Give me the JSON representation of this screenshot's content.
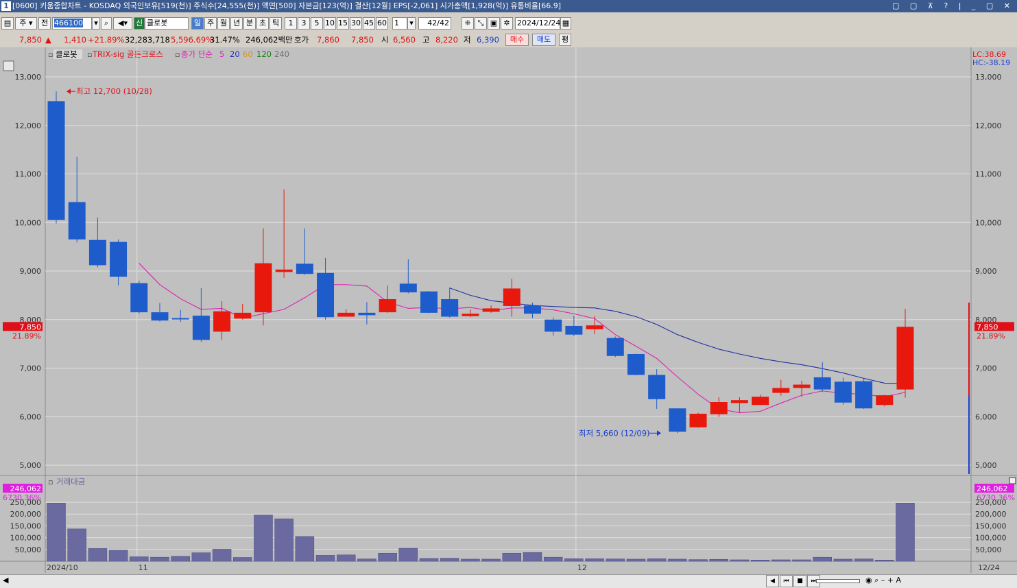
{
  "window": {
    "num": "1",
    "title": "[0600] 키움종합차트 - KOSDAQ 외국인보유[519(천)] 주식수[24,555(천)] 액면[500] 자본금[123(억)] 결산[12월] EPS[-2,061] 시가총액[1,928(억)] 유통비율[66.9]",
    "controls": "▢ ▢ ⊼ ? | _ ▢ ✕"
  },
  "toolbar": {
    "market": "주",
    "scope": "전",
    "code": "466100",
    "badge": "신",
    "stock_name": "클로봇",
    "periods": [
      "일",
      "주",
      "월",
      "년",
      "분",
      "초",
      "틱"
    ],
    "active_period": "일",
    "intervals": [
      "1",
      "3",
      "5",
      "10",
      "15",
      "30",
      "45",
      "60"
    ],
    "count": "1",
    "page": "42/42",
    "date": "2024/12/24"
  },
  "quote": {
    "price": "7,850",
    "arrow": "▲",
    "change": "1,410",
    "change_pct": "+21.89%",
    "volume": "32,283,718",
    "vol_ratio": "5,596.69%",
    "turnover": "31.47%",
    "amount": "246,062백만",
    "hoga_label": "호가",
    "ask": "7,860",
    "bid": "7,850",
    "open_label": "시",
    "open": "6,560",
    "high_label": "고",
    "high": "8,220",
    "low_label": "저",
    "low": "6,390",
    "buy": "매수",
    "sell": "매도",
    "avg": "평"
  },
  "colors": {
    "up": "#e8180c",
    "down": "#1e5ccc",
    "ma5": "#e020b0",
    "ma20": "#2030a0",
    "bg": "#c0c0c0",
    "vol": "#6a6aa0"
  },
  "chart_data": {
    "type": "candlestick",
    "legend": {
      "name": "클로봇",
      "indicator": "TRIX-sig 골든크로스",
      "ma_label": "종가 단순",
      "ma_periods": [
        "5",
        "20",
        "60",
        "120",
        "240"
      ]
    },
    "price_axis": {
      "ticks": [
        "13,000",
        "12,000",
        "11,000",
        "10,000",
        "9,000",
        "8,000",
        "7,000",
        "6,000",
        "5,000"
      ],
      "ylim": [
        4800,
        13400
      ]
    },
    "lc": "LC:38.69",
    "hc": "HC:-38.19",
    "current_price_tag": "7,850",
    "current_pct_tag": "21.89%",
    "annotations": {
      "high": "최고 12,700 (10/28)",
      "low": "최저 5,660 (12/09)"
    },
    "x_labels": [
      "2024/10",
      "11",
      "12",
      "12/24"
    ],
    "candles": [
      {
        "o": 12500,
        "h": 12700,
        "l": 9980,
        "c": 10050
      },
      {
        "o": 10420,
        "h": 11350,
        "l": 9590,
        "c": 9650
      },
      {
        "o": 9640,
        "h": 10100,
        "l": 9080,
        "c": 9120
      },
      {
        "o": 9600,
        "h": 9650,
        "l": 8700,
        "c": 8880
      },
      {
        "o": 8750,
        "h": 8800,
        "l": 8120,
        "c": 8150
      },
      {
        "o": 8150,
        "h": 8340,
        "l": 7960,
        "c": 7980
      },
      {
        "o": 8030,
        "h": 8200,
        "l": 7950,
        "c": 8010
      },
      {
        "o": 8080,
        "h": 8650,
        "l": 7540,
        "c": 7580
      },
      {
        "o": 7750,
        "h": 8380,
        "l": 7580,
        "c": 8170
      },
      {
        "o": 8020,
        "h": 8320,
        "l": 8000,
        "c": 8140
      },
      {
        "o": 8150,
        "h": 9880,
        "l": 7880,
        "c": 9160
      },
      {
        "o": 8980,
        "h": 10680,
        "l": 8860,
        "c": 9030
      },
      {
        "o": 9150,
        "h": 9880,
        "l": 8920,
        "c": 8940
      },
      {
        "o": 8960,
        "h": 9270,
        "l": 8000,
        "c": 8050
      },
      {
        "o": 8060,
        "h": 8210,
        "l": 8060,
        "c": 8140
      },
      {
        "o": 8140,
        "h": 8360,
        "l": 7900,
        "c": 8090
      },
      {
        "o": 8150,
        "h": 8700,
        "l": 8140,
        "c": 8420
      },
      {
        "o": 8740,
        "h": 9240,
        "l": 8540,
        "c": 8560
      },
      {
        "o": 8580,
        "h": 8590,
        "l": 8130,
        "c": 8140
      },
      {
        "o": 8420,
        "h": 8660,
        "l": 8040,
        "c": 8060
      },
      {
        "o": 8070,
        "h": 8210,
        "l": 8050,
        "c": 8120
      },
      {
        "o": 8160,
        "h": 8290,
        "l": 8140,
        "c": 8230
      },
      {
        "o": 8280,
        "h": 8840,
        "l": 8060,
        "c": 8640
      },
      {
        "o": 8290,
        "h": 8350,
        "l": 8030,
        "c": 8120
      },
      {
        "o": 8000,
        "h": 8040,
        "l": 7670,
        "c": 7750
      },
      {
        "o": 7870,
        "h": 8080,
        "l": 7660,
        "c": 7690
      },
      {
        "o": 7800,
        "h": 8070,
        "l": 7700,
        "c": 7880
      },
      {
        "o": 7620,
        "h": 7650,
        "l": 7230,
        "c": 7250
      },
      {
        "o": 7290,
        "h": 7300,
        "l": 6850,
        "c": 6860
      },
      {
        "o": 6860,
        "h": 6980,
        "l": 6160,
        "c": 6360
      },
      {
        "o": 6170,
        "h": 6180,
        "l": 5660,
        "c": 5690
      },
      {
        "o": 5780,
        "h": 6080,
        "l": 5770,
        "c": 6060
      },
      {
        "o": 6050,
        "h": 6400,
        "l": 5990,
        "c": 6300
      },
      {
        "o": 6280,
        "h": 6400,
        "l": 6080,
        "c": 6340
      },
      {
        "o": 6240,
        "h": 6450,
        "l": 6240,
        "c": 6410
      },
      {
        "o": 6490,
        "h": 6760,
        "l": 6430,
        "c": 6590
      },
      {
        "o": 6590,
        "h": 6740,
        "l": 6410,
        "c": 6660
      },
      {
        "o": 6810,
        "h": 7120,
        "l": 6510,
        "c": 6560
      },
      {
        "o": 6720,
        "h": 6800,
        "l": 6250,
        "c": 6290
      },
      {
        "o": 6730,
        "h": 6790,
        "l": 6160,
        "c": 6170
      },
      {
        "o": 6240,
        "h": 6450,
        "l": 6210,
        "c": 6440
      },
      {
        "o": 6560,
        "h": 8220,
        "l": 6390,
        "c": 7850
      }
    ],
    "ma5": [
      null,
      null,
      null,
      null,
      9160,
      8720,
      8430,
      8210,
      8230,
      8030,
      8120,
      8210,
      8450,
      8720,
      8720,
      8690,
      8360,
      8230,
      8250,
      8220,
      8250,
      8180,
      8240,
      8240,
      8200,
      8120,
      8020,
      7690,
      7450,
      7200,
      6820,
      6460,
      6160,
      6080,
      6110,
      6280,
      6440,
      6530,
      6480,
      6460,
      6410,
      6500
    ],
    "ma20": [
      null,
      null,
      null,
      null,
      null,
      null,
      null,
      null,
      null,
      null,
      null,
      null,
      null,
      null,
      null,
      null,
      null,
      null,
      null,
      8650,
      8500,
      8390,
      8340,
      8290,
      8270,
      8250,
      8240,
      8170,
      8060,
      7900,
      7690,
      7530,
      7390,
      7290,
      7200,
      7130,
      7070,
      6990,
      6900,
      6790,
      6690,
      6680
    ],
    "volume_axis": {
      "ticks": [
        "250,000",
        "200,000",
        "150,000",
        "100,000",
        "50,000"
      ],
      "ylim": [
        0,
        255000
      ]
    },
    "volume_title": "거래대금",
    "volume_tag": "246,062",
    "volume_pct_tag": "6730.36%",
    "volume": [
      246000,
      137000,
      54000,
      47000,
      19000,
      17000,
      21000,
      36000,
      51000,
      16000,
      196000,
      180000,
      105000,
      25000,
      27000,
      10000,
      34000,
      55000,
      12000,
      13000,
      9000,
      9000,
      34000,
      37000,
      17000,
      11000,
      11000,
      10000,
      9000,
      11000,
      9000,
      7000,
      8000,
      6000,
      5000,
      6000,
      6000,
      17000,
      9000,
      10000,
      5000,
      246062
    ]
  },
  "bottom": {
    "scroll_btns": [
      "◀",
      "⏮",
      "■",
      "⏭"
    ],
    "tools": "◉ ⌕ – + A"
  }
}
